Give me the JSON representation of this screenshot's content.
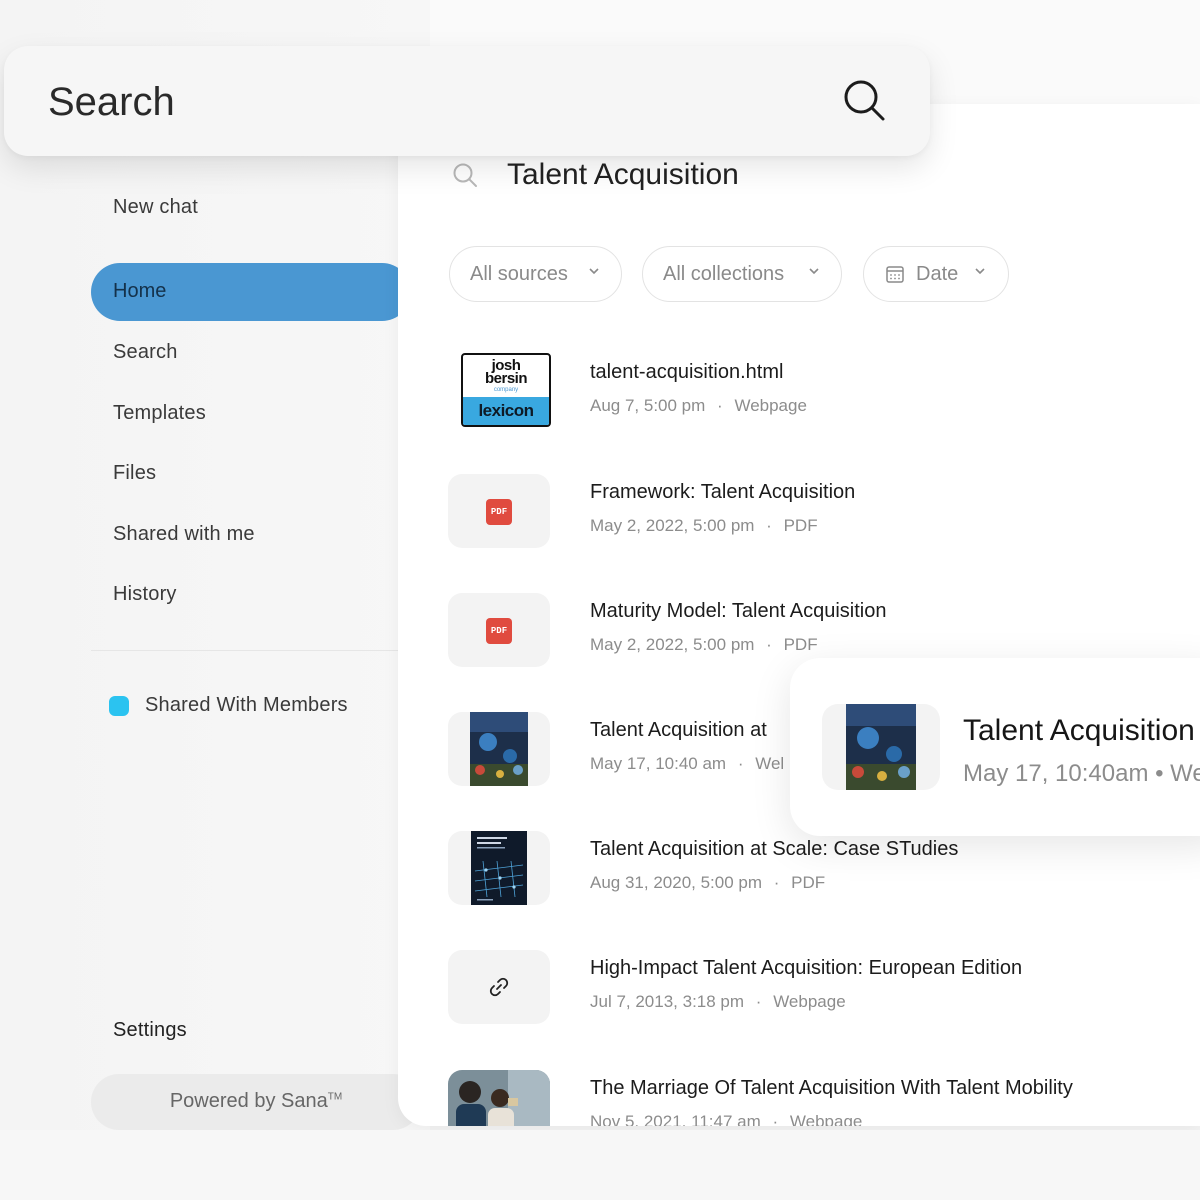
{
  "search_bar": {
    "placeholder": "Search"
  },
  "sidebar": {
    "new_chat": "New chat",
    "items": [
      {
        "label": "Home",
        "active": true
      },
      {
        "label": "Search"
      },
      {
        "label": "Templates"
      },
      {
        "label": "Files"
      },
      {
        "label": "Shared with me"
      },
      {
        "label": "History"
      }
    ],
    "collection": {
      "label": "Shared With Members",
      "color": "#2bc3f0"
    },
    "settings": "Settings",
    "powered_by": "Powered by Sana",
    "trademark": "TM"
  },
  "main": {
    "query": "Talent Acquisition",
    "filters": [
      {
        "label": "All sources"
      },
      {
        "label": "All collections"
      },
      {
        "label": "Date",
        "icon": "calendar-icon"
      }
    ],
    "results": [
      {
        "title": "talent-acquisition.html",
        "date": "Aug 7, 5:00 pm",
        "type": "Webpage",
        "thumb": "josh-bersin-lexicon-logo",
        "logo_text": [
          "josh",
          "bersin",
          "company",
          "lexicon"
        ]
      },
      {
        "title": "Framework: Talent Acquisition",
        "date": "May 2, 2022, 5:00 pm",
        "type": "PDF",
        "thumb": "pdf-icon",
        "badge": "PDF"
      },
      {
        "title": "Maturity Model: Talent Acquisition",
        "date": "May 2, 2022, 5:00 pm",
        "type": "PDF",
        "thumb": "pdf-icon",
        "badge": "PDF"
      },
      {
        "title": "Talent Acquisition at",
        "date": "May 17, 10:40 am",
        "type": "Wel",
        "thumb": "image-thumbnail"
      },
      {
        "title": "Talent Acquisition at Scale: Case STudies",
        "date": "Aug 31, 2020, 5:00 pm",
        "type": "PDF",
        "thumb": "book-cover-thumbnail"
      },
      {
        "title": "High-Impact Talent Acquisition: European Edition",
        "date": "Jul 7, 2013, 3:18 pm",
        "type": "Webpage",
        "thumb": "link-icon"
      },
      {
        "title": "The Marriage Of Talent Acquisition With Talent Mobility",
        "date": "Nov 5, 2021, 11:47 am",
        "type": "Webpage",
        "thumb": "photo-thumbnail"
      }
    ],
    "separator": "·"
  },
  "popup": {
    "title": "Talent Acquisition",
    "meta": "May 17, 10:40am • We"
  },
  "colors": {
    "accent": "#4a97d2",
    "pdf": "#e04b3f",
    "collection_dot": "#2bc3f0"
  }
}
